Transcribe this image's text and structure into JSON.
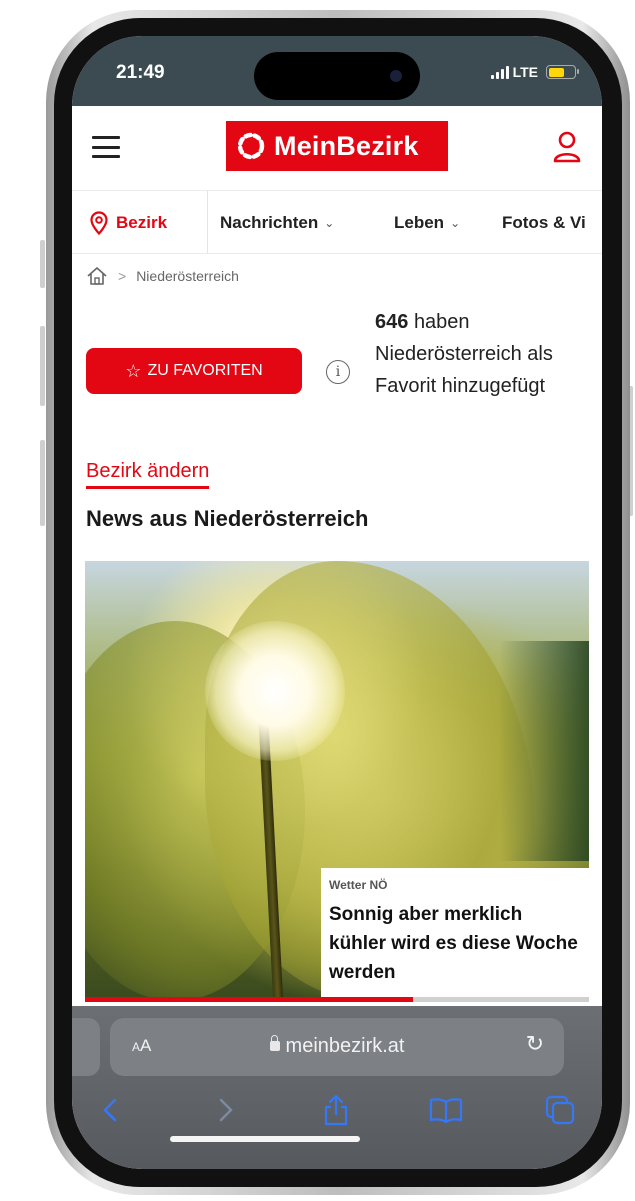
{
  "status_bar": {
    "time": "21:49",
    "network": "LTE",
    "battery_color": "#ffd60a"
  },
  "header": {
    "logo_text": "MeinBezirk",
    "brand_color": "#e30613",
    "menu_icon": "hamburger-icon",
    "user_icon": "user-icon"
  },
  "nav": {
    "bezirk_label": "Bezirk",
    "items": [
      {
        "label": "Nachrichten",
        "has_dropdown": true
      },
      {
        "label": "Leben",
        "has_dropdown": true
      },
      {
        "label": "Fotos & Vi",
        "has_dropdown": false
      }
    ]
  },
  "breadcrumb": {
    "separator": ">",
    "current": "Niederösterreich"
  },
  "favorites": {
    "button_label": "ZU FAVORITEN",
    "count": "646",
    "count_text": "haben Niederösterreich als Favorit hinzugefügt"
  },
  "region": {
    "change_link": "Bezirk ändern",
    "news_heading": "News aus Niederösterreich"
  },
  "article": {
    "category": "Wetter NÖ",
    "title": "Sonnig aber merklich kühler wird es diese Woche werden",
    "carousel_progress": 0.65
  },
  "browser": {
    "aa_label_small": "A",
    "aa_label": "A",
    "url": "meinbezirk.at",
    "toolbar_color": "#3478f6"
  }
}
